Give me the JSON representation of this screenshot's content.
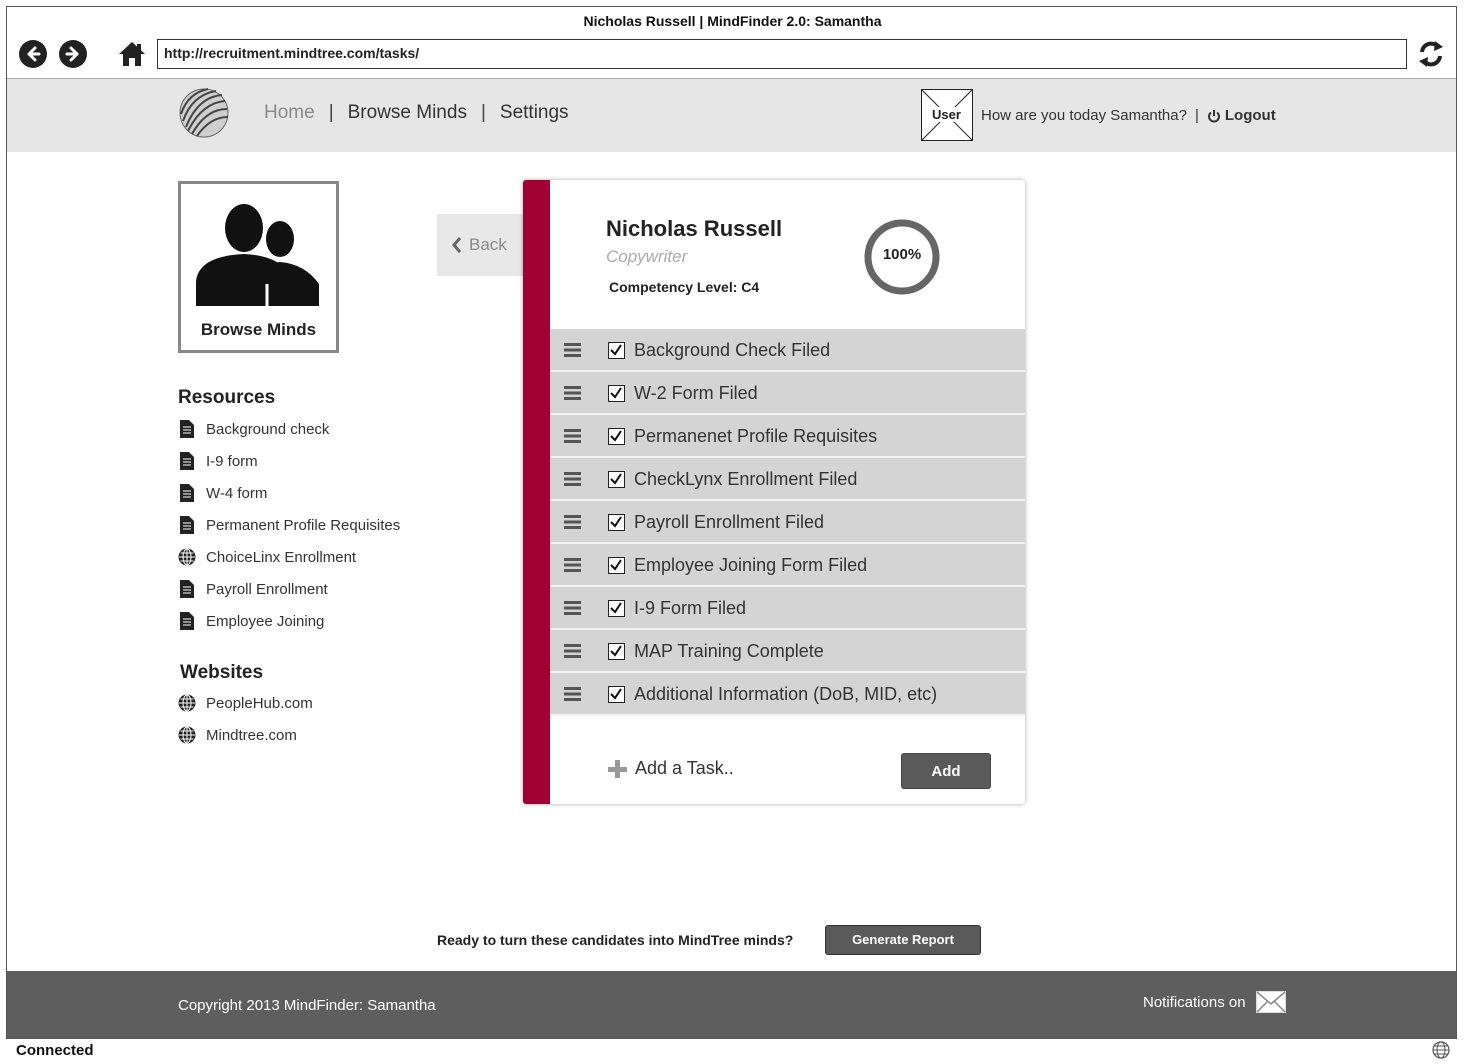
{
  "window": {
    "title": "Nicholas Russell | MindFinder 2.0: Samantha",
    "url": "http://recruitment.mindtree.com/tasks/",
    "status": "Connected"
  },
  "header": {
    "nav": {
      "home": "Home",
      "browse": "Browse Minds",
      "settings": "Settings",
      "separator": "|"
    },
    "user_placeholder": "User",
    "greeting": "How are you today Samantha?",
    "separator": "|",
    "logout": "Logout"
  },
  "sidebar": {
    "browse_card_label": "Browse Minds",
    "resources_title": "Resources",
    "resources": [
      {
        "label": "Background check",
        "icon": "document-icon"
      },
      {
        "label": "I-9 form",
        "icon": "document-icon"
      },
      {
        "label": "W-4 form",
        "icon": "document-icon"
      },
      {
        "label": "Permanent Profile Requisites",
        "icon": "document-icon"
      },
      {
        "label": "ChoiceLinx Enrollment",
        "icon": "globe-icon"
      },
      {
        "label": "Payroll Enrollment",
        "icon": "document-icon"
      },
      {
        "label": "Employee Joining",
        "icon": "document-icon"
      }
    ],
    "websites_title": "Websites",
    "websites": [
      {
        "label": "PeopleHub.com",
        "icon": "globe-icon"
      },
      {
        "label": "Mindtree.com",
        "icon": "globe-icon"
      }
    ]
  },
  "back_label": "Back",
  "candidate": {
    "name": "Nicholas Russell",
    "role": "Copywriter",
    "competency": "Competency Level: C4",
    "progress_label": "100%",
    "progress_value": 100,
    "accent": "#a00034"
  },
  "tasks": [
    {
      "label": "Background Check Filed",
      "checked": true
    },
    {
      "label": "W-2 Form Filed",
      "checked": true
    },
    {
      "label": "Permanenet Profile Requisites",
      "checked": true
    },
    {
      "label": "CheckLynx Enrollment Filed",
      "checked": true
    },
    {
      "label": "Payroll Enrollment Filed",
      "checked": true
    },
    {
      "label": "Employee Joining Form Filed",
      "checked": true
    },
    {
      "label": "I-9 Form Filed",
      "checked": true
    },
    {
      "label": "MAP Training Complete",
      "checked": true
    },
    {
      "label": "Additional Information (DoB, MID, etc)",
      "checked": true
    }
  ],
  "add_task": {
    "placeholder": "Add a Task..",
    "button": "Add"
  },
  "report": {
    "question": "Ready to turn these candidates into MindTree minds?",
    "button": "Generate Report"
  },
  "footer": {
    "copyright": "Copyright 2013 MindFinder: Samantha",
    "notifications": "Notifications on"
  }
}
